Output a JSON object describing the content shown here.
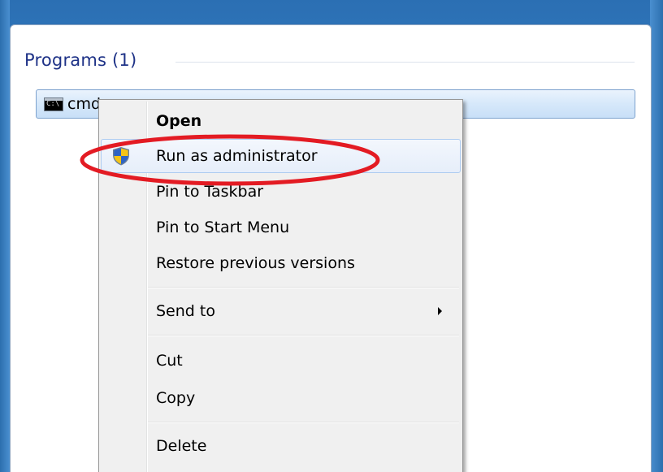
{
  "search_results": {
    "group_header": "Programs (1)",
    "item_label": "cmd",
    "item_icon_text": "C:\\",
    "item_icon": "cmd-icon"
  },
  "context_menu": {
    "items": [
      {
        "label": "Open",
        "bold": true
      },
      {
        "label": "Run as administrator",
        "icon": "uac-shield-icon",
        "highlighted": true
      },
      {
        "label": "Pin to Taskbar"
      },
      {
        "label": "Pin to Start Menu"
      },
      {
        "label": "Restore previous versions"
      },
      {
        "label": "Send to",
        "submenu": true
      },
      {
        "label": "Cut"
      },
      {
        "label": "Copy"
      },
      {
        "label": "Delete"
      }
    ]
  },
  "annotation": {
    "shape": "ellipse",
    "color": "#e31b23",
    "target": "Run as administrator"
  },
  "colors": {
    "group_header": "#1e3287",
    "selection_border": "#7da2ce",
    "menu_background": "#f0f0f0"
  }
}
